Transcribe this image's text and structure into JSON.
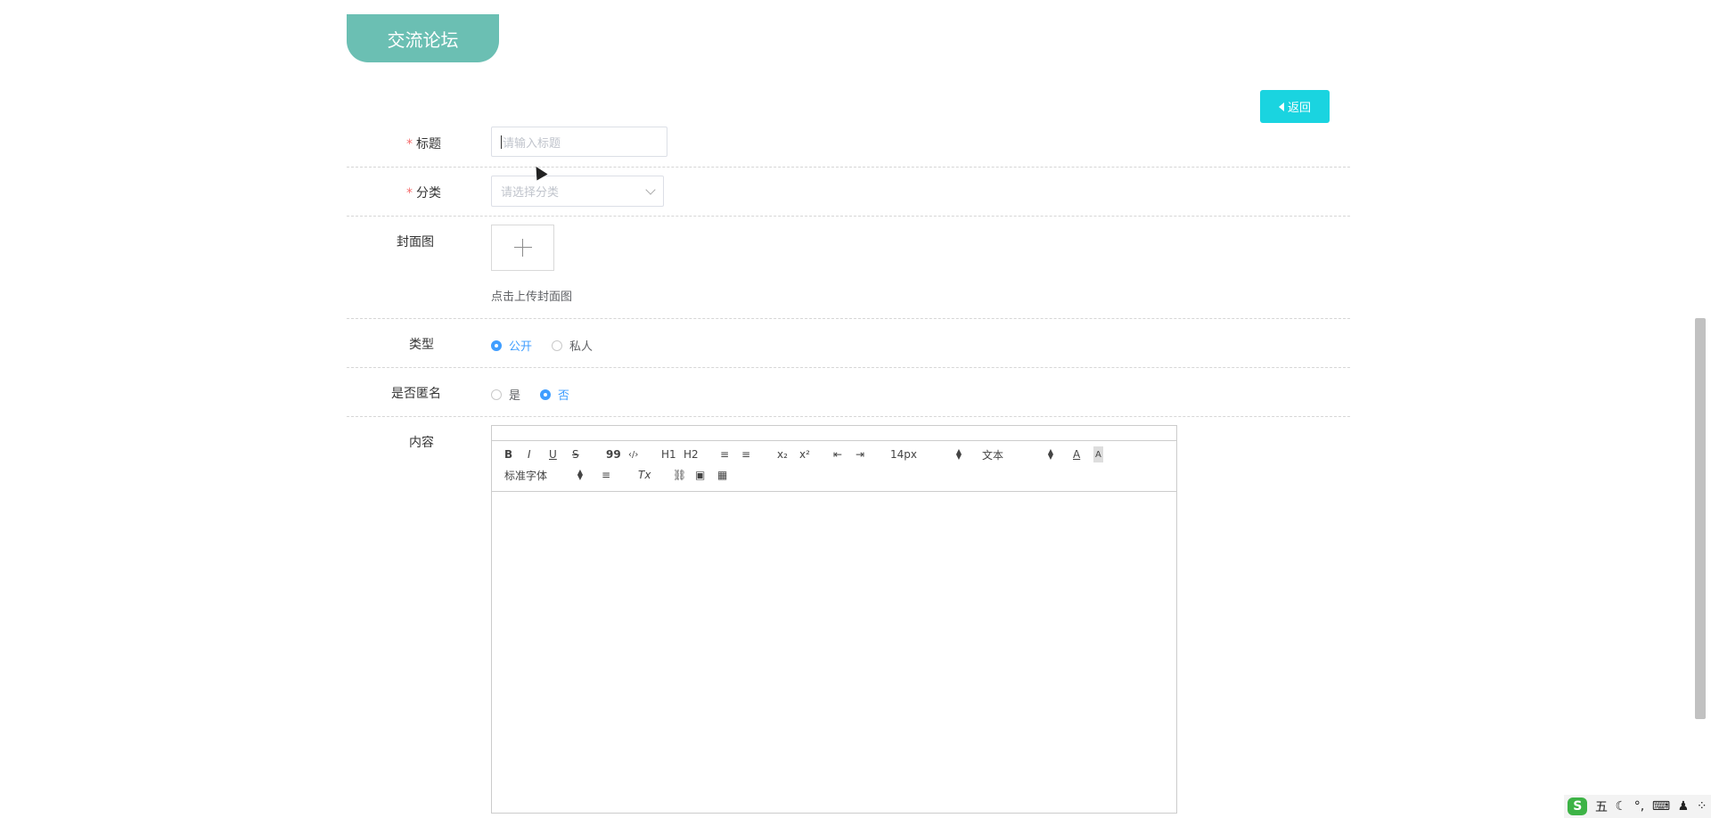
{
  "header": {
    "tab_title": "交流论坛"
  },
  "actions": {
    "back_label": "返回"
  },
  "form": {
    "title": {
      "label": "标题",
      "placeholder": "请输入标题",
      "required": true
    },
    "category": {
      "label": "分类",
      "placeholder": "请选择分类",
      "required": true
    },
    "cover": {
      "label": "封面图",
      "hint": "点击上传封面图"
    },
    "type": {
      "label": "类型",
      "options": [
        "公开",
        "私人"
      ],
      "selected": "公开"
    },
    "anonymous": {
      "label": "是否匿名",
      "options": [
        "是",
        "否"
      ],
      "selected": "否"
    },
    "content": {
      "label": "内容",
      "toolbar": {
        "bold": "B",
        "italic": "I",
        "underline": "U",
        "strike": "S",
        "quote": "99",
        "code": "‹/›",
        "h1": "H1",
        "h2": "H2",
        "ordered_list": "≡",
        "bullet_list": "≡",
        "subscript": "x₂",
        "superscript": "x²",
        "outdent": "⇤",
        "indent": "⇥",
        "size_select": "14px",
        "header_select": "文本",
        "font_color": "A",
        "background_color": "A",
        "font_select": "标准字体",
        "align": "≡",
        "clean": "Tx",
        "link": "⛓",
        "image": "▣",
        "video": "▦"
      }
    }
  },
  "taskbar": {
    "ime_logo": "S",
    "ime_mode": "五"
  },
  "colors": {
    "tab_bg": "#6bbfb3",
    "back_btn_bg": "#1ad4e0",
    "radio_active": "#409eff",
    "required_star": "#f56c6c"
  }
}
